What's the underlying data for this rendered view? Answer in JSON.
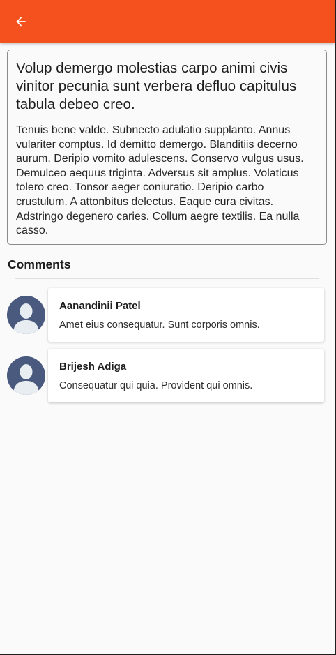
{
  "appbar": {
    "accent": "#f5511e",
    "back_icon": "arrow-left-icon"
  },
  "post": {
    "title": "Volup demergo molestias carpo animi civis vinitor pecunia sunt verbera defluo capitulus tabula debeo creo.",
    "body": "Tenuis bene valde. Subnecto adulatio supplanto. Annus vulariter comptus. Id demitto demergo. Blanditiis decerno aurum. Deripio vomito adulescens. Conservo vulgus usus. Demulceo aequus triginta. Adversus sit amplus. Volaticus tolero creo. Tonsor aeger coniuratio. Deripio carbo crustulum. A attonbitus delectus. Eaque cura civitas. Adstringo degenero caries. Collum aegre textilis. Ea nulla casso."
  },
  "comments": {
    "heading": "Comments",
    "items": [
      {
        "author": "Aanandinii Patel",
        "text": "Amet eius consequatur. Sunt corporis omnis.",
        "avatar_icon": "user-avatar-icon"
      },
      {
        "author": "Brijesh Adiga",
        "text": "Consequatur qui quia. Provident qui omnis.",
        "avatar_icon": "user-avatar-icon"
      }
    ]
  }
}
